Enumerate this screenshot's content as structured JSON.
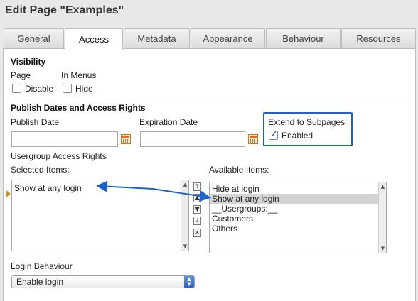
{
  "header": {
    "title": "Edit Page \"Examples\""
  },
  "tabs": [
    {
      "label": "General",
      "active": false
    },
    {
      "label": "Access",
      "active": true
    },
    {
      "label": "Metadata",
      "active": false
    },
    {
      "label": "Appearance",
      "active": false
    },
    {
      "label": "Behaviour",
      "active": false
    },
    {
      "label": "Resources",
      "active": false
    }
  ],
  "visibility": {
    "heading": "Visibility",
    "page_label": "Page",
    "in_menus_label": "In Menus",
    "disable_label": "Disable",
    "disable_checked": false,
    "hide_label": "Hide",
    "hide_checked": false
  },
  "publish": {
    "heading": "Publish Dates and Access Rights",
    "publish_date_label": "Publish Date",
    "publish_date_value": "",
    "expiration_date_label": "Expiration Date",
    "expiration_date_value": "",
    "extend_label": "Extend to Subpages",
    "enabled_label": "Enabled",
    "enabled_checked": true
  },
  "access": {
    "heading": "Usergroup Access Rights",
    "selected_label": "Selected Items:",
    "available_label": "Available Items:",
    "selected_items": [
      "Show at any login"
    ],
    "available_items": [
      {
        "label": "Hide at login",
        "selected": false
      },
      {
        "label": "Show at any login",
        "selected": true
      },
      {
        "label": "__Usergroups:__",
        "selected": false
      },
      {
        "label": "Customers",
        "selected": false
      },
      {
        "label": "Others",
        "selected": false
      }
    ],
    "move_buttons": [
      "move-top",
      "move-up",
      "move-down",
      "move-bottom",
      "remove"
    ]
  },
  "login": {
    "label": "Login Behaviour",
    "selected": "Enable login"
  },
  "colors": {
    "annotation_blue": "#1b63c9",
    "selected_row": "#d4d4d4",
    "calendar_orange": "#e36f1e"
  },
  "icons": [
    "calendar-icon",
    "checkbox",
    "scroll-up-arrow",
    "scroll-down-arrow",
    "select-arrows-icon"
  ]
}
